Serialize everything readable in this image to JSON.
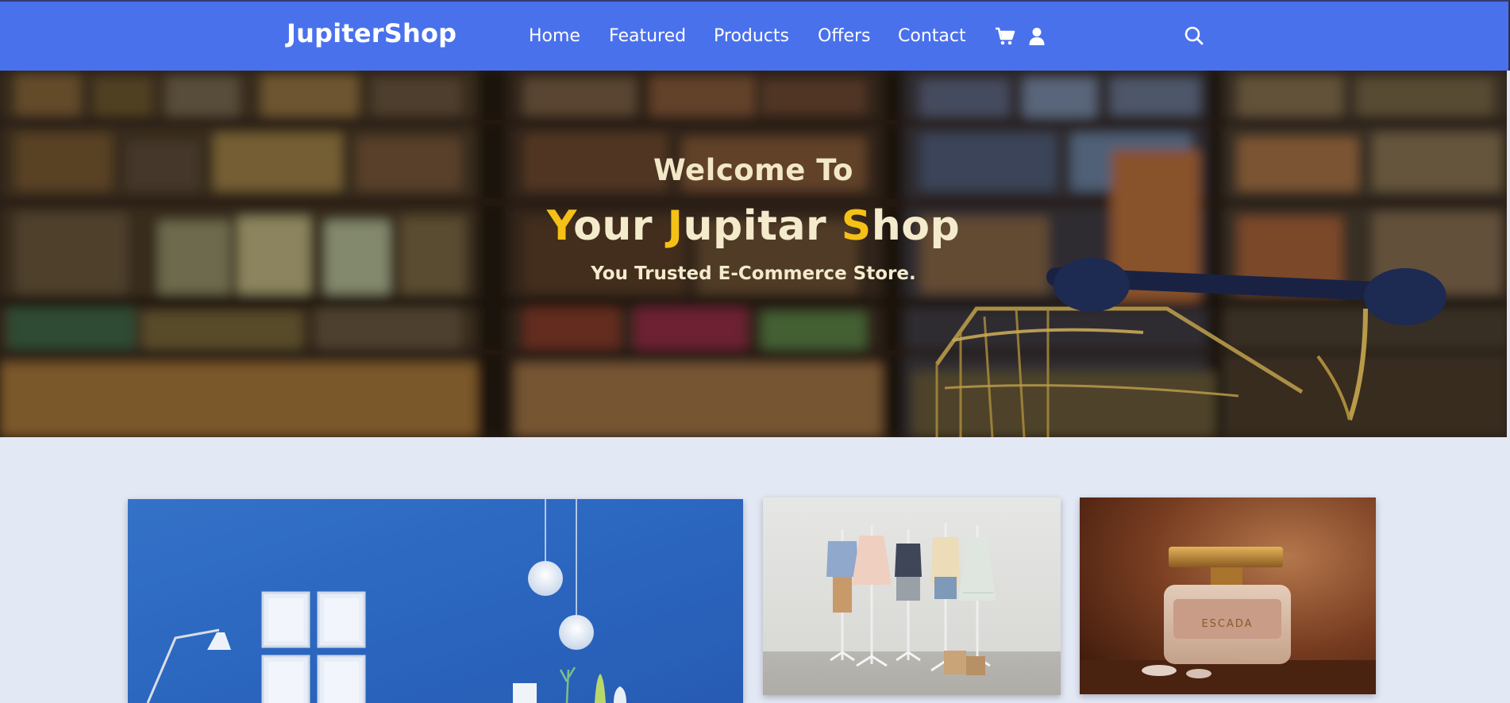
{
  "navbar": {
    "brand": "JupiterShop",
    "links": [
      "Home",
      "Featured",
      "Products",
      "Offers",
      "Contact"
    ],
    "icons": [
      "cart-icon",
      "user-icon",
      "search-icon"
    ],
    "background_color": "#4a71ec"
  },
  "hero": {
    "welcome": "Welcome To",
    "headline_words": [
      {
        "initial": "Y",
        "rest": "our"
      },
      {
        "initial": "J",
        "rest": "upitar"
      },
      {
        "initial": "S",
        "rest": "hop"
      }
    ],
    "tagline": "You Trusted E-Commerce Store.",
    "accent_color": "#f5c116",
    "text_color": "#f4ebcd"
  },
  "cards": {
    "perfume_label": "ESCADA"
  },
  "page_background": "#e3e8f5"
}
